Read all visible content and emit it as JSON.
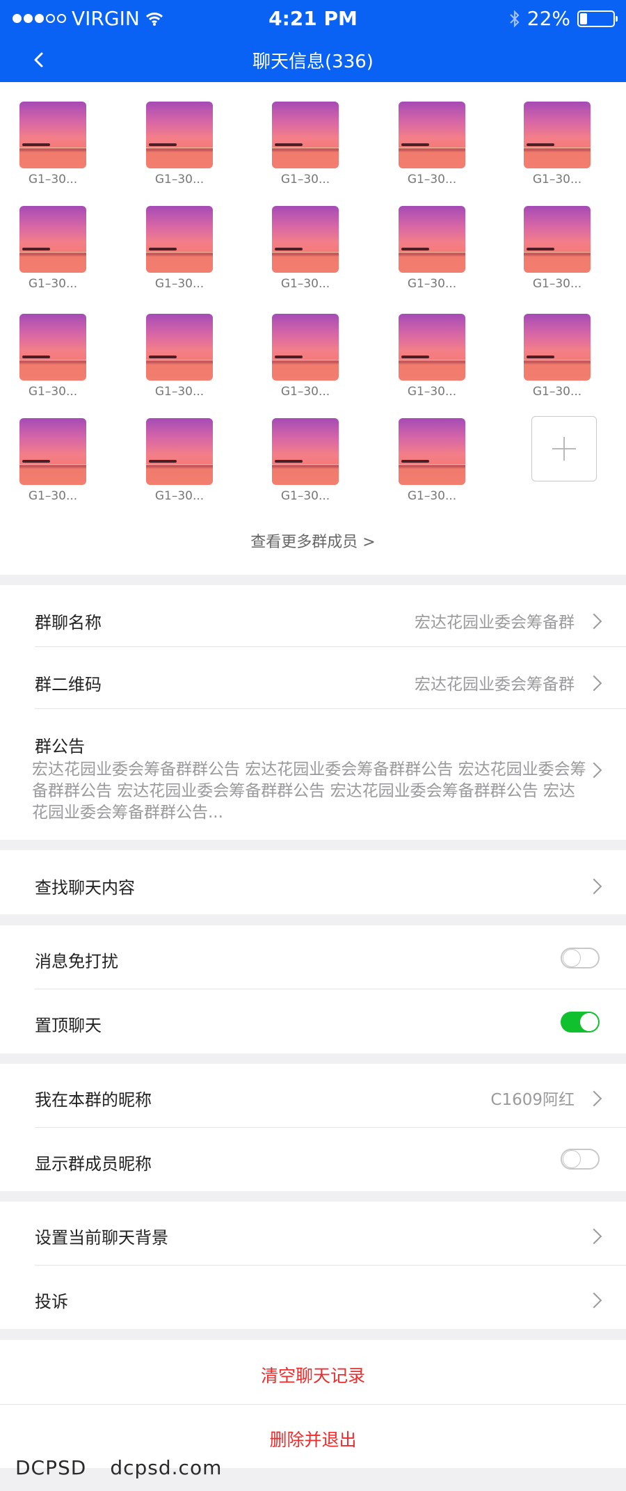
{
  "status_bar": {
    "carrier": "VIRGIN",
    "time": "4:21 PM",
    "battery_percent": "22%",
    "battery_level": 0.22,
    "icons": [
      "signal-dots-icon",
      "wifi-icon",
      "bluetooth-icon",
      "battery-icon"
    ]
  },
  "nav": {
    "back_icon": "chevron-left-icon",
    "title": "聊天信息(336)"
  },
  "members": [
    {
      "name": "G1–30..."
    },
    {
      "name": "G1–30..."
    },
    {
      "name": "G1–30..."
    },
    {
      "name": "G1–30..."
    },
    {
      "name": "G1–30..."
    },
    {
      "name": "G1–30..."
    },
    {
      "name": "G1–30..."
    },
    {
      "name": "G1–30..."
    },
    {
      "name": "G1–30..."
    },
    {
      "name": "G1–30..."
    },
    {
      "name": "G1–30..."
    },
    {
      "name": "G1–30..."
    },
    {
      "name": "G1–30..."
    },
    {
      "name": "G1–30..."
    },
    {
      "name": "G1–30..."
    },
    {
      "name": "G1–30..."
    },
    {
      "name": "G1–30..."
    },
    {
      "name": "G1–30..."
    },
    {
      "name": "G1–30..."
    }
  ],
  "add_member_icon": "plus-icon",
  "view_more": "查看更多群成员 >",
  "group_info": {
    "name_label": "群聊名称",
    "name_value": "宏达花园业委会筹备群",
    "qrcode_label": "群二维码",
    "qrcode_value": "宏达花园业委会筹备群",
    "notice_label": "群公告",
    "notice_text": "宏达花园业委会筹备群群公告 宏达花园业委会筹备群群公告 宏达花园业委会筹备群群公告 宏达花园业委会筹备群群公告 宏达花园业委会筹备群群公告 宏达花园业委会筹备群群公告..."
  },
  "search_chat": "查找聊天内容",
  "settings": {
    "mute_label": "消息免打扰",
    "mute_on": false,
    "pin_label": "置顶聊天",
    "pin_on": true
  },
  "nickname": {
    "my_nick_label": "我在本群的昵称",
    "my_nick_value": "C1609阿红",
    "show_nick_label": "显示群成员昵称",
    "show_nick_on": false
  },
  "other": {
    "background_label": "设置当前聊天背景",
    "report_label": "投诉"
  },
  "actions": {
    "clear": "清空聊天记录",
    "delete_exit": "删除并退出"
  },
  "watermark": {
    "brand": "DCPSD",
    "site": "dcpsd.com"
  },
  "colors": {
    "header_blue": "#0a62f5",
    "toggle_green": "#10c02e",
    "danger_red": "#ee2c2c"
  }
}
